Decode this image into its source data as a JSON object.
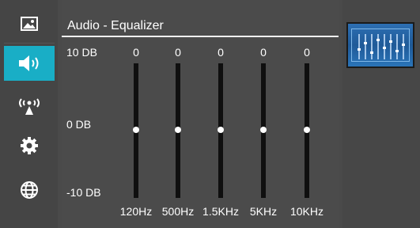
{
  "sidebar": {
    "items": [
      {
        "icon": "picture-icon",
        "active": false
      },
      {
        "icon": "speaker-icon",
        "active": true
      },
      {
        "icon": "broadcast-icon",
        "active": false
      },
      {
        "icon": "gear-icon",
        "active": false
      },
      {
        "icon": "globe-icon",
        "active": false
      }
    ]
  },
  "header": {
    "title": "Audio - Equalizer"
  },
  "scale": {
    "top": "10 DB",
    "middle": "0 DB",
    "bottom": "-10 DB"
  },
  "bands": [
    {
      "value": "0",
      "freq": "120Hz"
    },
    {
      "value": "0",
      "freq": "500Hz"
    },
    {
      "value": "0",
      "freq": "1.5KHz"
    },
    {
      "value": "0",
      "freq": "5KHz"
    },
    {
      "value": "0",
      "freq": "10KHz"
    }
  ],
  "colors": {
    "accent": "#19aec6",
    "background": "#4a4a4a",
    "track": "#0f0f0f"
  }
}
